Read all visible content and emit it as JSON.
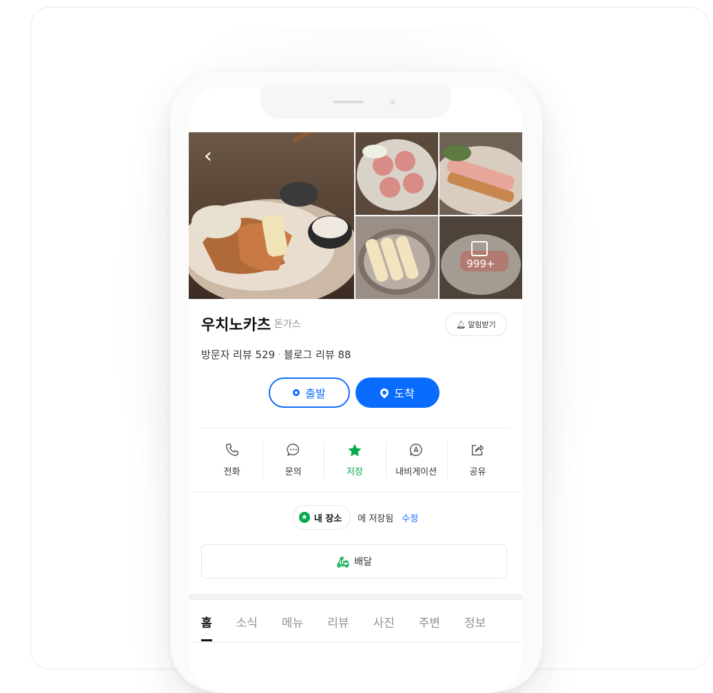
{
  "place": {
    "name": "우치노카츠",
    "category": "돈가스",
    "notify_label": "알림받기",
    "visitor_reviews_label": "방문자 리뷰 529",
    "blog_reviews_label": "블로그 리뷰 88"
  },
  "gallery": {
    "more_count": "999+"
  },
  "route": {
    "depart_label": "출발",
    "arrive_label": "도착"
  },
  "actions": [
    {
      "label": "전화",
      "icon": "phone-icon"
    },
    {
      "label": "문의",
      "icon": "chat-icon"
    },
    {
      "label": "저장",
      "icon": "star-icon"
    },
    {
      "label": "내비게이션",
      "icon": "navigation-icon"
    },
    {
      "label": "공유",
      "icon": "share-icon"
    }
  ],
  "saved": {
    "list_label": "내 장소",
    "saved_text": "에 저장됨",
    "edit_label": "수정"
  },
  "delivery": {
    "label": "배달"
  },
  "tabs": [
    "홈",
    "소식",
    "메뉴",
    "리뷰",
    "사진",
    "주변",
    "정보"
  ],
  "colors": {
    "accent": "#0a6cff",
    "saved_green": "#03a94d"
  }
}
